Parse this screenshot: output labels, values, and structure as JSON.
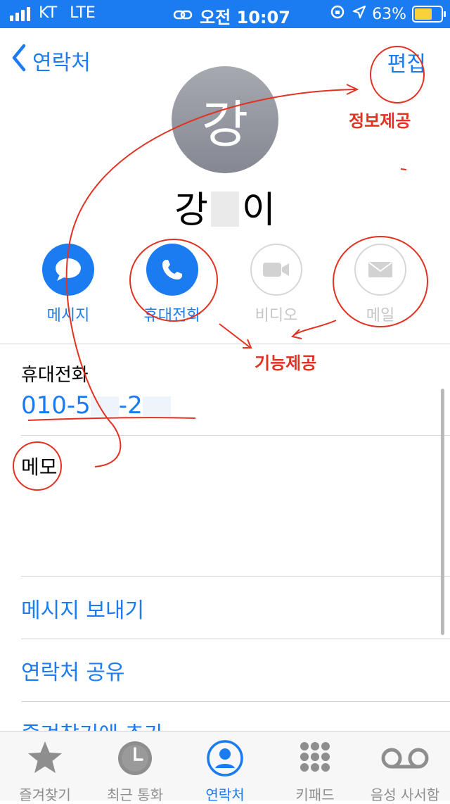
{
  "status_bar": {
    "carrier": "KT",
    "network": "LTE",
    "time": "오전 10:07",
    "battery": "63%"
  },
  "nav": {
    "back_label": "연락처",
    "edit_label": "편집"
  },
  "contact": {
    "avatar_initial": "강",
    "name_first": "강",
    "name_last": "이"
  },
  "actions": [
    {
      "label": "메시지",
      "enabled": true,
      "icon": "message-icon"
    },
    {
      "label": "휴대전화",
      "enabled": true,
      "icon": "phone-icon"
    },
    {
      "label": "비디오",
      "enabled": false,
      "icon": "video-icon"
    },
    {
      "label": "메일",
      "enabled": false,
      "icon": "mail-icon"
    }
  ],
  "details": {
    "phone_label": "휴대전화",
    "phone_prefix": "010-5",
    "phone_middle": "-2",
    "memo_label": "메모"
  },
  "rows": {
    "send_message": "메시지 보내기",
    "share_contact": "연락처 공유",
    "add_favorites": "즐겨찾기에 추가"
  },
  "tabs": [
    {
      "label": "즐겨찾기",
      "icon": "star-icon"
    },
    {
      "label": "최근 통화",
      "icon": "clock-icon"
    },
    {
      "label": "연락처",
      "icon": "person-icon",
      "active": true
    },
    {
      "label": "키패드",
      "icon": "keypad-icon"
    },
    {
      "label": "음성 사서함",
      "icon": "voicemail-icon"
    }
  ],
  "annotations": {
    "info_label": "정보제공",
    "function_label": "기능제공"
  },
  "colors": {
    "accent": "#1b7cf2",
    "annotation": "#e13222"
  }
}
